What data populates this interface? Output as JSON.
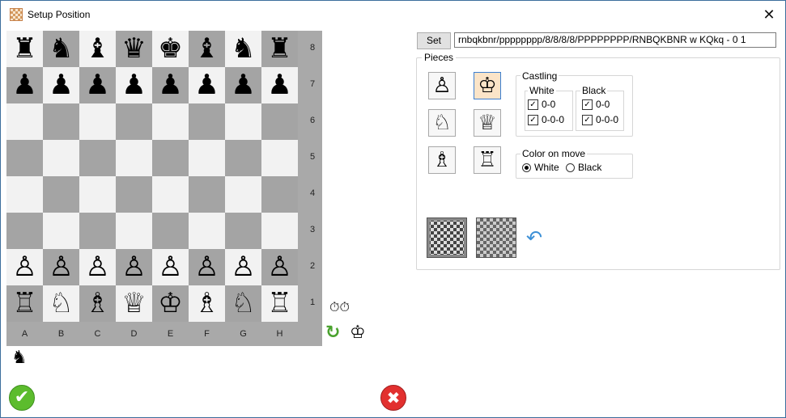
{
  "window": {
    "title": "Setup Position",
    "close_glyph": "✕"
  },
  "board": {
    "ranks": [
      "8",
      "7",
      "6",
      "5",
      "4",
      "3",
      "2",
      "1"
    ],
    "files": [
      "A",
      "B",
      "C",
      "D",
      "E",
      "F",
      "G",
      "H"
    ],
    "rows": [
      [
        "♜",
        "♞",
        "♝",
        "♛",
        "♚",
        "♝",
        "♞",
        "♜"
      ],
      [
        "♟",
        "♟",
        "♟",
        "♟",
        "♟",
        "♟",
        "♟",
        "♟"
      ],
      [
        "",
        "",
        "",
        "",
        "",
        "",
        "",
        ""
      ],
      [
        "",
        "",
        "",
        "",
        "",
        "",
        "",
        ""
      ],
      [
        "",
        "",
        "",
        "",
        "",
        "",
        "",
        ""
      ],
      [
        "",
        "",
        "",
        "",
        "",
        "",
        "",
        ""
      ],
      [
        "♙",
        "♙",
        "♙",
        "♙",
        "♙",
        "♙",
        "♙",
        "♙"
      ],
      [
        "♖",
        "♘",
        "♗",
        "♕",
        "♔",
        "♗",
        "♘",
        "♖"
      ]
    ]
  },
  "side_icons": {
    "clock": "⏱⏱",
    "rotate": "↻",
    "king": "♔",
    "engine": "♞"
  },
  "actions": {
    "ok": "✔",
    "cancel": "✖"
  },
  "fen": {
    "set_label": "Set",
    "value": "rnbqkbnr/pppppppp/8/8/8/8/PPPPPPPP/RNBQKBNR w KQkq - 0 1"
  },
  "pieces": {
    "label": "Pieces",
    "palette": [
      {
        "glyph": "♙",
        "name": "pawn",
        "selected": false
      },
      {
        "glyph": "♔",
        "name": "king",
        "selected": true
      },
      {
        "glyph": "♘",
        "name": "knight",
        "selected": false
      },
      {
        "glyph": "♕",
        "name": "queen",
        "selected": false
      },
      {
        "glyph": "♗",
        "name": "bishop",
        "selected": false
      },
      {
        "glyph": "♖",
        "name": "rook",
        "selected": false
      }
    ],
    "castling": {
      "label": "Castling",
      "white": {
        "label": "White",
        "short": "0-0",
        "long": "0-0-0",
        "short_checked": true,
        "long_checked": true
      },
      "black": {
        "label": "Black",
        "short": "0-0",
        "long": "0-0-0",
        "short_checked": true,
        "long_checked": true
      }
    },
    "color_on_move": {
      "label": "Color on move",
      "white": "White",
      "black": "Black",
      "selected": "White"
    },
    "undo_glyph": "↶"
  }
}
